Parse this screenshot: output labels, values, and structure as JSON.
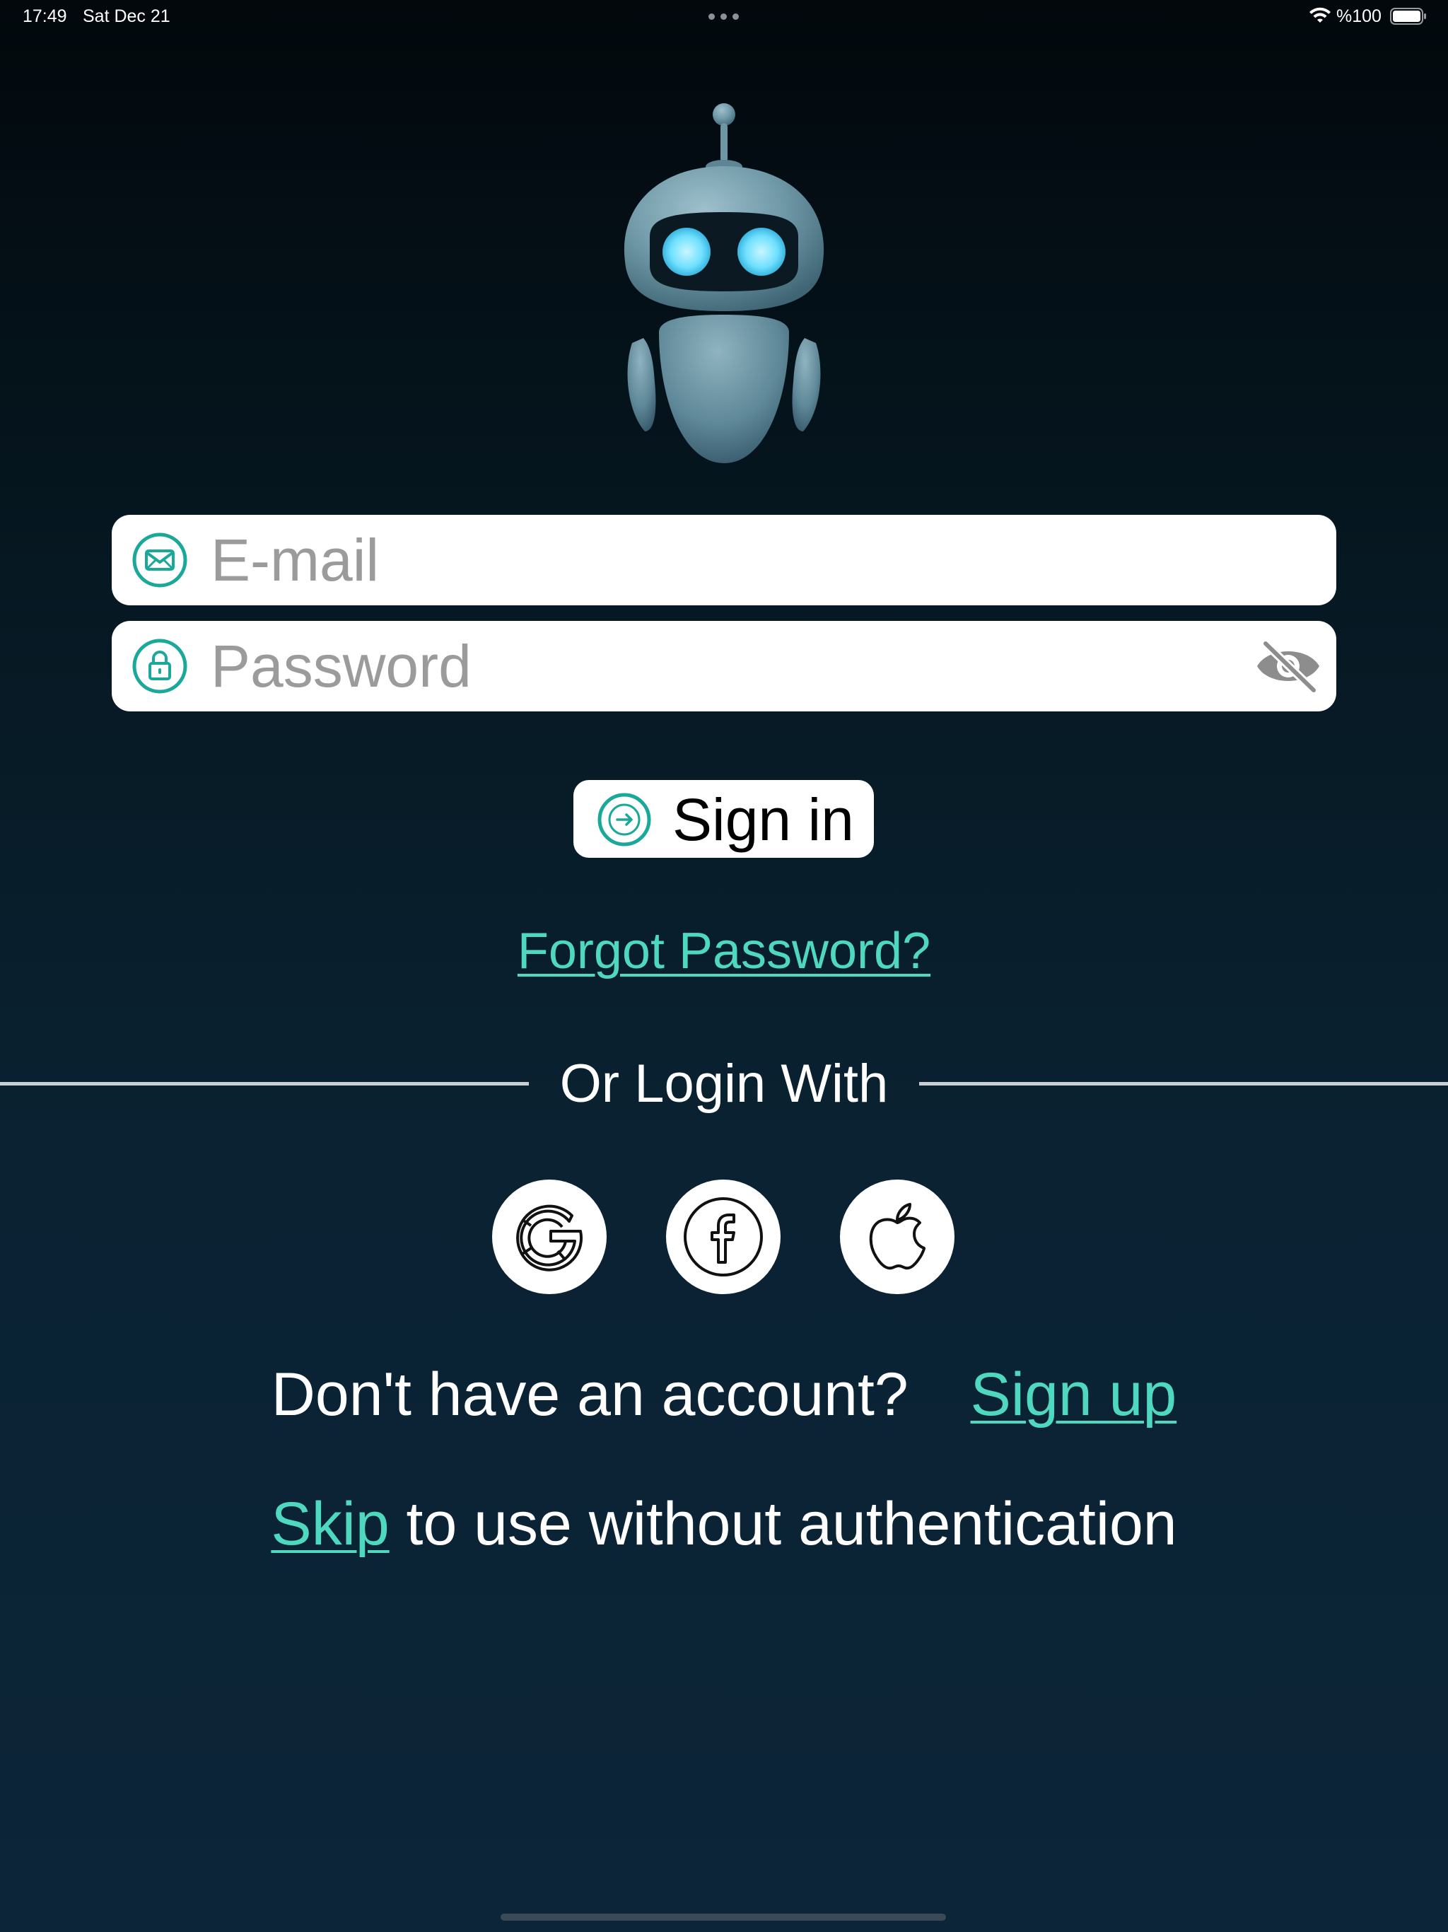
{
  "status_bar": {
    "time": "17:49",
    "date": "Sat Dec 21",
    "battery_text": "%100",
    "wifi_icon": "wifi-icon",
    "battery_icon": "battery-full-icon"
  },
  "logo": {
    "icon": "robot-mascot"
  },
  "form": {
    "email": {
      "placeholder": "E-mail",
      "value": "",
      "icon": "envelope-icon"
    },
    "password": {
      "placeholder": "Password",
      "value": "",
      "icon": "lock-icon",
      "toggle_icon": "eye-slash-icon"
    },
    "sign_in": {
      "label": "Sign in",
      "icon": "arrow-right-circle-icon"
    },
    "forgot_password": "Forgot Password?"
  },
  "social": {
    "divider_text": "Or Login With",
    "providers": [
      {
        "name": "Google",
        "icon": "google-icon"
      },
      {
        "name": "Facebook",
        "icon": "facebook-icon"
      },
      {
        "name": "Apple",
        "icon": "apple-icon"
      }
    ]
  },
  "signup": {
    "prompt": "Don't have an account?",
    "link": "Sign up"
  },
  "skip": {
    "link": "Skip",
    "text": " to use without authentication"
  },
  "colors": {
    "accent": "#4fd8c0",
    "icon_teal": "#19a89a",
    "background_top": "#02080c",
    "background_bottom": "#0c2538"
  }
}
